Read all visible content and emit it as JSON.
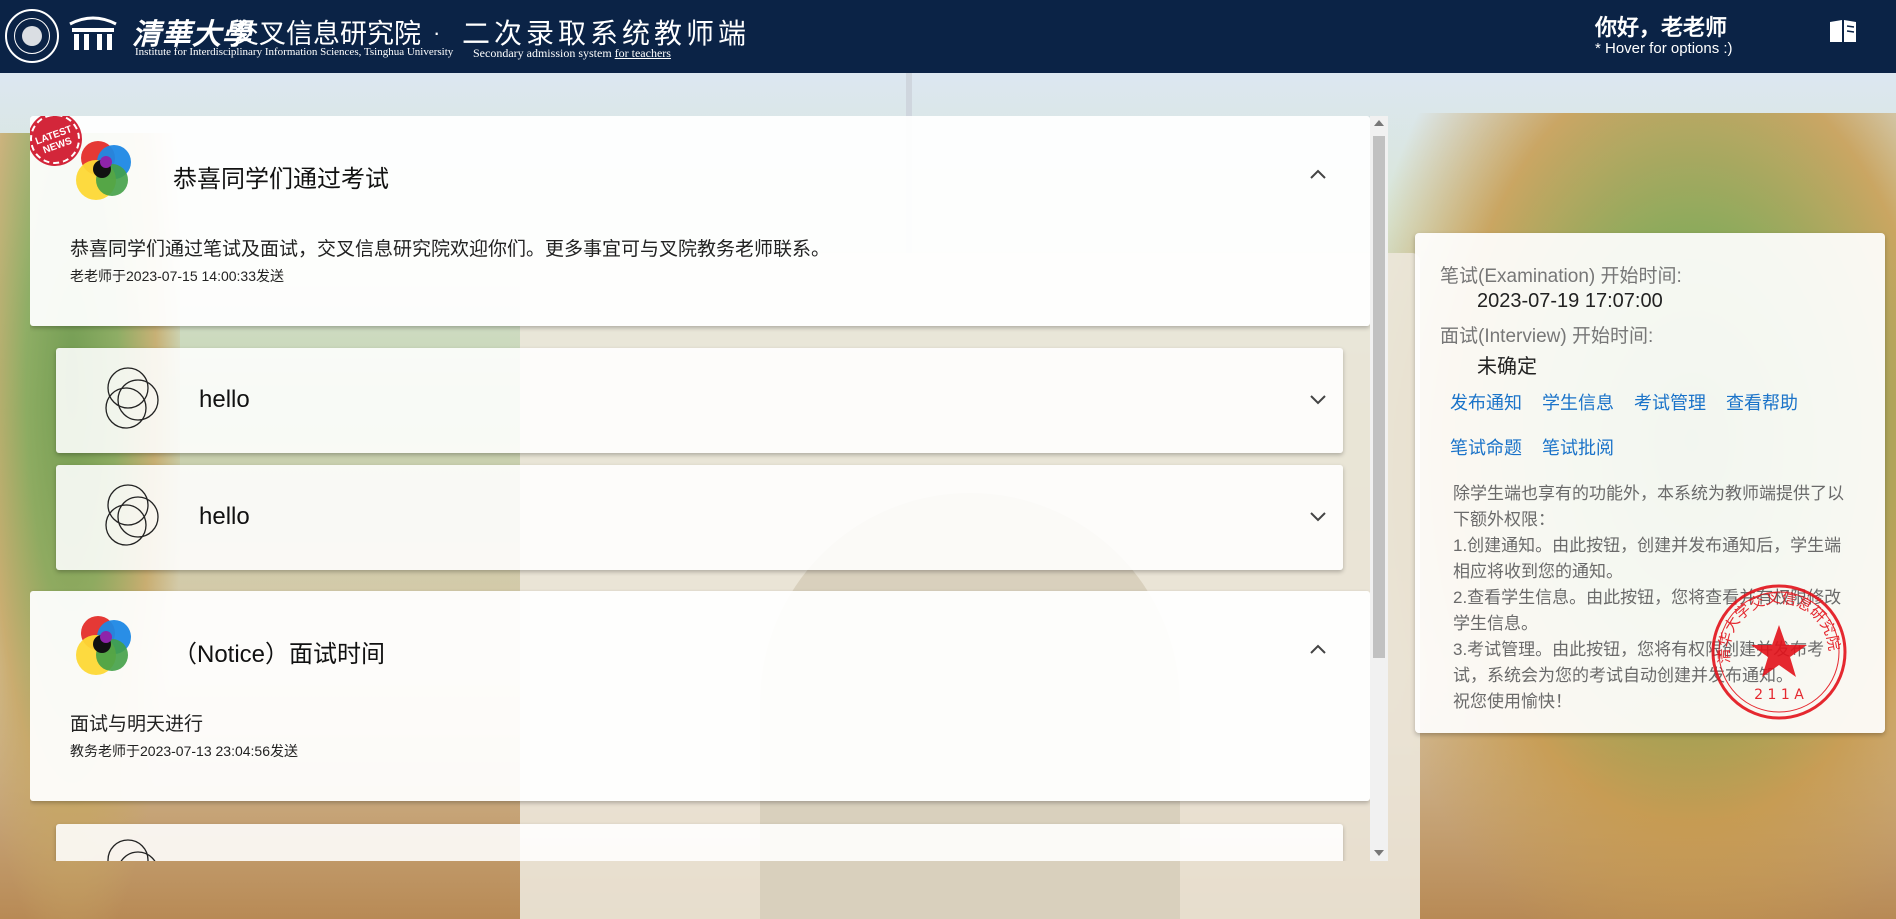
{
  "header": {
    "university": "清華大學",
    "institute_cn": "交叉信息研究院",
    "institute_en": "Institute for Interdisciplinary Information Sciences, Tsinghua University",
    "separator": "·",
    "system_cn": "二次录取系统教师端",
    "system_en_prefix": "Secondary admission system ",
    "system_en_link": "for teachers",
    "greeting": "你好，老老师",
    "hover_tip": "* Hover for options :)",
    "book_icon": "book-icon"
  },
  "feed": {
    "news_badge": "LATEST NEWS",
    "cards": [
      {
        "title": "恭喜同学们通过考试",
        "body": "恭喜同学们通过笔试及面试，交叉信息研究院欢迎你们。更多事宜可与叉院教务老师联系。",
        "meta": "老老师于2023-07-15 14:00:33发送"
      },
      {
        "title": "hello"
      },
      {
        "title": "hello"
      },
      {
        "title": "（Notice）面试时间",
        "body": "面试与明天进行",
        "meta": "教务老师于2023-07-13 23:04:56发送"
      }
    ]
  },
  "panel": {
    "exam_label": "笔试(Examination) 开始时间:",
    "exam_value": "2023-07-19 17:07:00",
    "interview_label": "面试(Interview) 开始时间:",
    "interview_value": "未确定",
    "links": [
      "发布通知",
      "学生信息",
      "考试管理",
      "查看帮助",
      "笔试命题",
      "笔试批阅"
    ],
    "description": [
      "除学生端也享有的功能外，本系统为教师端提供了以下额外权限：",
      "1.创建通知。由此按钮，创建并发布通知后，学生端相应将收到您的通知。",
      "2.查看学生信息。由此按钮，您将查看并有权限修改学生信息。",
      "3.考试管理。由此按钮，您将有权限创建并发布考试，系统会为您的考试自动创建并发布通知。",
      "祝您使用愉快！"
    ],
    "stamp_text": "清华大学交叉信息研究院",
    "stamp_code": "2 1 1 A"
  }
}
